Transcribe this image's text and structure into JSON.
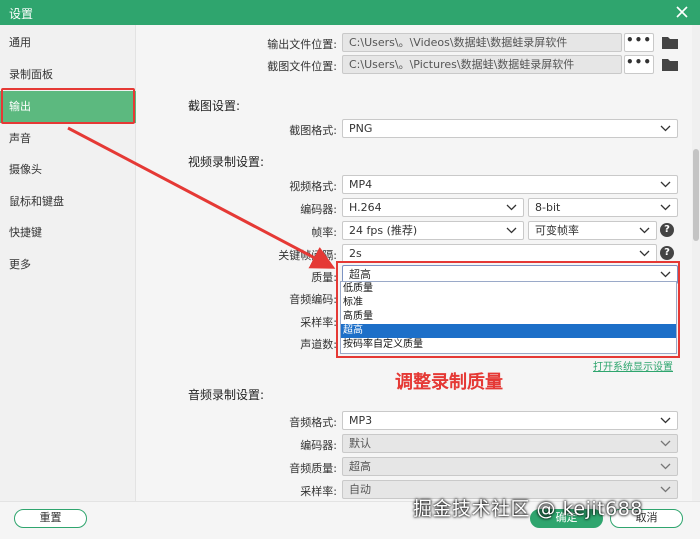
{
  "window": {
    "title": "设置"
  },
  "sidebar": {
    "items": [
      {
        "label": "通用"
      },
      {
        "label": "录制面板"
      },
      {
        "label": "输出"
      },
      {
        "label": "声音"
      },
      {
        "label": "摄像头"
      },
      {
        "label": "鼠标和键盘"
      },
      {
        "label": "快捷键"
      },
      {
        "label": "更多"
      }
    ],
    "active": "输出"
  },
  "paths": {
    "output_label": "输出文件位置:",
    "output_value": "C:\\Users\\。\\Videos\\数据蛙\\数据蛙录屏软件",
    "screenshot_label": "截图文件位置:",
    "screenshot_value": "C:\\Users\\。\\Pictures\\数据蛙\\数据蛙录屏软件",
    "dots": "•••"
  },
  "screenshot_settings": {
    "heading": "截图设置:",
    "format_label": "截图格式:",
    "format_value": "PNG"
  },
  "video_settings": {
    "heading": "视频录制设置:",
    "format_label": "视频格式:",
    "format_value": "MP4",
    "encoder_label": "编码器:",
    "encoder_value": "H.264",
    "bitdepth_value": "8-bit",
    "fps_label": "帧率:",
    "fps_value": "24 fps (推荐)",
    "fps_mode_value": "可变帧率",
    "keyframe_label": "关键帧间隔:",
    "keyframe_value": "2s",
    "quality_label": "质量:",
    "quality_value": "超高",
    "audio_codec_label": "音频编码:",
    "samplerate_label": "采样率:",
    "channels_label": "声道数:",
    "help_glyph": "?"
  },
  "quality_dropdown": {
    "options": [
      "低质量",
      "标准",
      "高质量",
      "超高",
      "按码率自定义质量"
    ],
    "selected": "超高"
  },
  "display_link": "打开系统显示设置",
  "annotation": "调整录制质量",
  "audio_settings": {
    "heading": "音频录制设置:",
    "format_label": "音频格式:",
    "format_value": "MP3",
    "encoder_label": "编码器:",
    "encoder_value": "默认",
    "quality_label": "音频质量:",
    "quality_value": "超高",
    "samplerate_label": "采样率:",
    "samplerate_value": "自动"
  },
  "footer": {
    "reset": "重置",
    "ok": "确定",
    "cancel": "取消"
  },
  "watermark": "掘金技术社区 @ kejit688",
  "colors": {
    "accent": "#2fa56e",
    "active": "#5cb97f",
    "highlight": "#e53935",
    "selection": "#1d6fc8"
  }
}
